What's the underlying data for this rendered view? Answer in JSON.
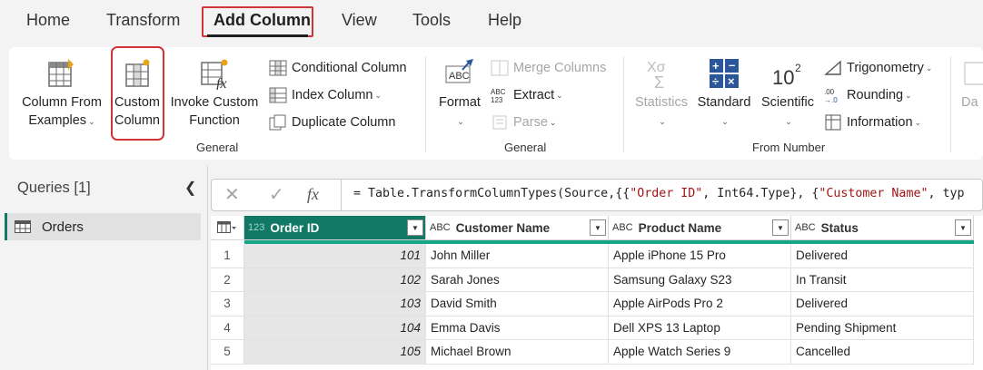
{
  "menu": {
    "tabs": [
      "Home",
      "Transform",
      "Add Column",
      "View",
      "Tools",
      "Help"
    ],
    "active": "Add Column"
  },
  "ribbon": {
    "general1": {
      "column_from_examples": [
        "Column From",
        "Examples"
      ],
      "custom_column": [
        "Custom",
        "Column"
      ],
      "invoke_custom_function": [
        "Invoke Custom",
        "Function"
      ],
      "conditional_column": "Conditional Column",
      "index_column": "Index Column",
      "duplicate_column": "Duplicate Column",
      "label": "General"
    },
    "general2": {
      "format": "Format",
      "merge_columns": "Merge Columns",
      "extract": "Extract",
      "parse": "Parse",
      "label": "General"
    },
    "from_number": {
      "statistics": "Statistics",
      "standard": "Standard",
      "scientific": "Scientific",
      "trigonometry": "Trigonometry",
      "rounding": "Rounding",
      "information": "Information",
      "label": "From Number"
    },
    "cutoff": "Da"
  },
  "queries": {
    "title": "Queries [1]",
    "items": [
      {
        "name": "Orders"
      }
    ]
  },
  "formula": {
    "prefix": "= Table.TransformColumnTypes(Source,{{",
    "s1": "\"Order ID\"",
    "mid": ", Int64.Type}, {",
    "s2": "\"Customer Name\"",
    "tail": ", typ"
  },
  "grid": {
    "columns": [
      {
        "name": "Order ID",
        "type": "123"
      },
      {
        "name": "Customer Name",
        "type": "ABC"
      },
      {
        "name": "Product Name",
        "type": "ABC"
      },
      {
        "name": "Status",
        "type": "ABC"
      }
    ],
    "rows": [
      [
        "1",
        "101",
        "John Miller",
        "Apple iPhone 15 Pro",
        "Delivered"
      ],
      [
        "2",
        "102",
        "Sarah Jones",
        "Samsung Galaxy S23",
        "In Transit"
      ],
      [
        "3",
        "103",
        "David Smith",
        "Apple AirPods Pro 2",
        "Delivered"
      ],
      [
        "4",
        "104",
        "Emma Davis",
        "Dell XPS 13 Laptop",
        "Pending Shipment"
      ],
      [
        "5",
        "105",
        "Michael Brown",
        "Apple Watch Series 9",
        "Cancelled"
      ]
    ]
  },
  "colors": {
    "accent": "#117865",
    "quality_bar": "#17a589",
    "highlight": "#d13438"
  }
}
